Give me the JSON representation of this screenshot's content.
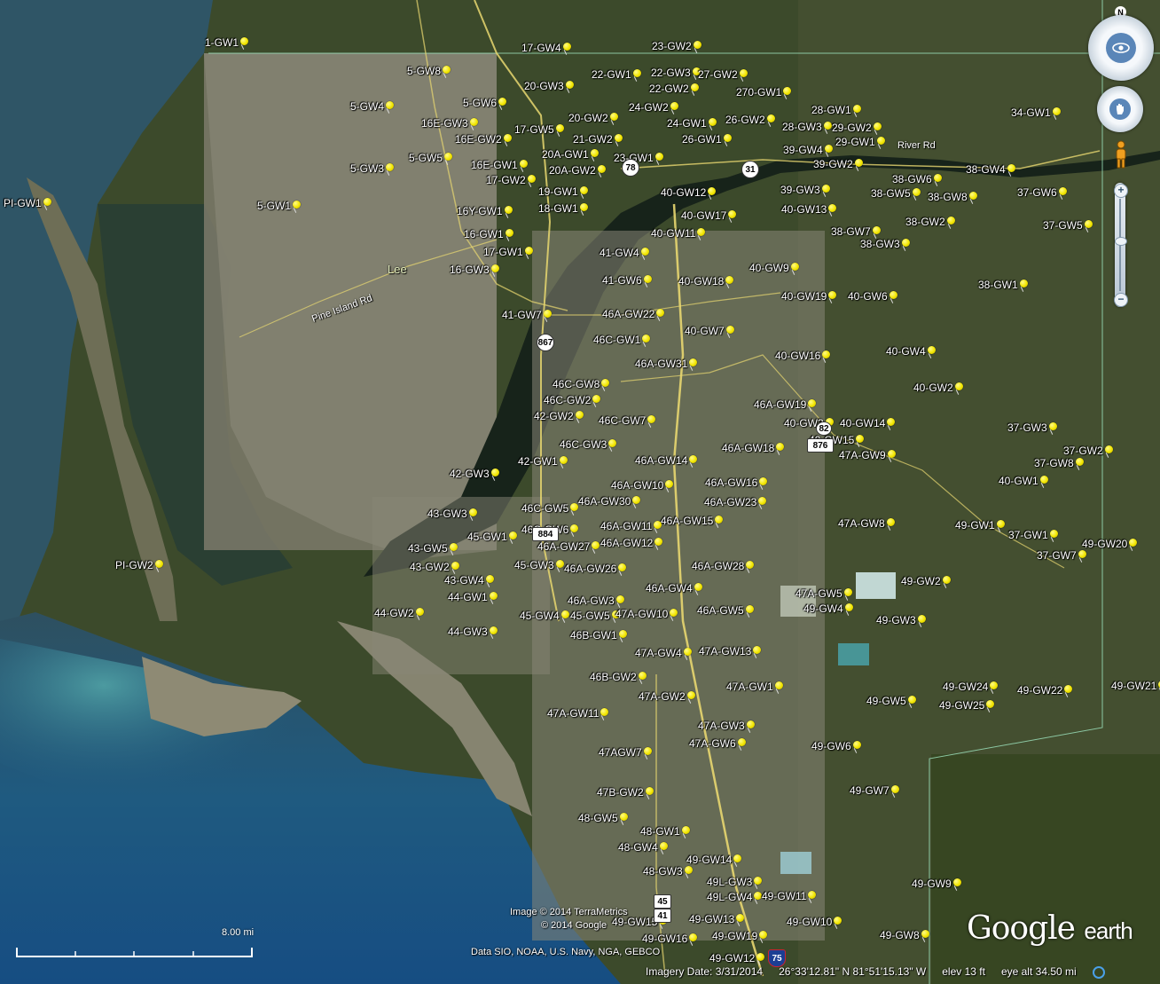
{
  "placemarks": [
    "1-GW1",
    "17-GW4",
    "23-GW2",
    "5-GW8",
    "22-GW1",
    "22-GW3",
    "27-GW2",
    "20-GW3",
    "22-GW2",
    "270-GW1",
    "5-GW4",
    "5-GW6",
    "24-GW2",
    "28-GW1",
    "34-GW1",
    "16E-GW3",
    "20-GW2",
    "24-GW1",
    "26-GW2",
    "28-GW3",
    "29-GW2",
    "17-GW5",
    "16E-GW2",
    "21-GW2",
    "26-GW1",
    "29-GW1",
    "5-GW5",
    "20A-GW1",
    "23-GW1",
    "39-GW4",
    "16E-GW1",
    "20A-GW2",
    "39-GW2",
    "5-GW3",
    "38-GW4",
    "17-GW2",
    "38-GW6",
    "19-GW1",
    "40-GW12",
    "39-GW3",
    "37-GW6",
    "PI-GW1",
    "5-GW1",
    "38-GW5",
    "38-GW8",
    "18-GW1",
    "40-GW13",
    "16Y-GW1",
    "40-GW17",
    "38-GW2",
    "37-GW5",
    "16-GW1",
    "40-GW11",
    "38-GW7",
    "38-GW3",
    "17-GW1",
    "41-GW4",
    "16-GW3",
    "40-GW9",
    "41-GW6",
    "40-GW18",
    "38-GW1",
    "40-GW19",
    "40-GW6",
    "41-GW7",
    "46A-GW22",
    "46C-GW1",
    "40-GW7",
    "40-GW16",
    "40-GW4",
    "46A-GW31",
    "46C-GW8",
    "40-GW2",
    "46C-GW2",
    "46A-GW19",
    "42-GW2",
    "46C-GW7",
    "40-GW3",
    "40-GW14",
    "37-GW3",
    "46C-GW3",
    "40-GW15",
    "46A-GW18",
    "37-GW2",
    "42-GW1",
    "46A-GW14",
    "47A-GW9",
    "37-GW8",
    "42-GW3",
    "46A-GW16",
    "40-GW1",
    "46A-GW10",
    "46A-GW30",
    "46A-GW23",
    "43-GW3",
    "46C-GW5",
    "46A-GW15",
    "47A-GW8",
    "49-GW1",
    "46A-GW11",
    "37-GW1",
    "45-GW1",
    "46C-GW6",
    "49-GW20",
    "43-GW5",
    "46A-GW27",
    "46A-GW12",
    "37-GW7",
    "45-GW3",
    "43-GW2",
    "46A-GW26",
    "46A-GW28",
    "PI-GW2",
    "49-GW2",
    "43-GW4",
    "46A-GW4",
    "47A-GW5",
    "44-GW1",
    "46A-GW3",
    "46A-GW5",
    "49-GW4",
    "44-GW2",
    "45-GW4",
    "45-GW5",
    "47A-GW10",
    "49-GW3",
    "46B-GW1",
    "44-GW3",
    "47A-GW4",
    "47A-GW13",
    "46B-GW2",
    "47A-GW1",
    "49-GW24",
    "49-GW22",
    "49-GW21",
    "47A-GW2",
    "49-GW5",
    "49-GW25",
    "47A-GW11",
    "47A-GW3",
    "47A-GW6",
    "49-GW6",
    "47AGW7",
    "49-GW7",
    "47B-GW2",
    "48-GW5",
    "48-GW1",
    "48-GW4",
    "49-GW14",
    "48-GW3",
    "49L-GW3",
    "49-GW9",
    "49L-GW4",
    "49-GW11",
    "49-GW15",
    "49-GW13",
    "49-GW10",
    "49-GW16",
    "49-GW19",
    "49-GW8",
    "49-GW12"
  ],
  "places": {
    "county": "Lee"
  },
  "roads": {
    "pine_island": "Pine Island Rd",
    "river": "River Rd"
  },
  "shields": {
    "sr78": "78",
    "sr31": "31",
    "sr867": "867",
    "sr82": "82",
    "cr876": "876",
    "sr884": "884",
    "sr45": "45",
    "us41": "41",
    "i75": "75"
  },
  "controls": {
    "north": "N",
    "zoom_in": "+",
    "zoom_out": "−"
  },
  "scale": {
    "label": "8.00 mi"
  },
  "attribution": {
    "image": "Image © 2014 TerraMetrics",
    "google": "© 2014 Google",
    "data": "Data SIO, NOAA, U.S. Navy, NGA, GEBCO"
  },
  "logo": {
    "google": "Google",
    "earth": "earth"
  },
  "status": {
    "imagery_date": "Imagery Date: 3/31/2014",
    "coords": "26°33'12.81\" N   81°51'15.13\" W",
    "elev": "elev    13 ft",
    "eye_alt": "eye alt  34.50 mi"
  },
  "colors": {
    "land": "#3b4a2a",
    "water_deep": "#1d4f7a",
    "urban": "#8d8a7e",
    "pin": "#f2e600"
  }
}
